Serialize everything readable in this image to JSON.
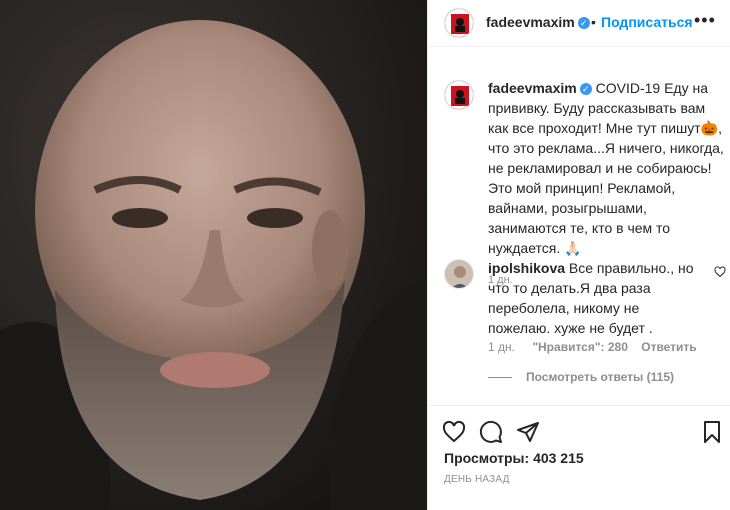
{
  "post": {
    "username": "fadeevmaxim",
    "follow_label": "Подписаться",
    "caption_text": "COVID-19 Еду на прививку. Буду рассказывать вам как все проходит! Мне тут пишут🎃, что это реклама...Я ничего, никогда, не рекламировал и не собираюсь! Это мой принцип! Рекламой, вайнами, розыгрышами, занимаются те, кто в чем то нуждается. 🙏🏻",
    "caption_time": "1 дн."
  },
  "comment": {
    "username": "ipolshikova",
    "text": "Все правильно., но что то делать.Я два раза переболела, никому не пожелаю. хуже не будет .",
    "time": "1 дн.",
    "likes": "\"Нравится\": 280",
    "reply_label": "Ответить",
    "view_replies": "Посмотреть ответы (115)"
  },
  "footer": {
    "views_label": "Просмотры:",
    "views_count": "403 215",
    "date_label": "ДЕНЬ НАЗАД"
  },
  "icons": {
    "verified": "verified-badge-icon",
    "like": "heart-icon",
    "comment": "comment-icon",
    "share": "paper-plane-icon",
    "save": "bookmark-icon",
    "more": "ellipsis-icon"
  },
  "colors": {
    "accent": "#0095f6",
    "verified": "#3897f0",
    "muted": "#8e8e8e",
    "logo_red": "#c9141e"
  }
}
